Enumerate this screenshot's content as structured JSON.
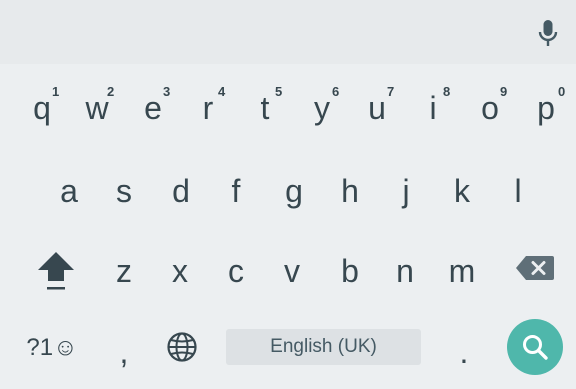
{
  "suggestion_bar": {
    "mic_icon": "microphone-icon"
  },
  "rows": {
    "row1": [
      {
        "key": "q",
        "hint": "1"
      },
      {
        "key": "w",
        "hint": "2"
      },
      {
        "key": "e",
        "hint": "3"
      },
      {
        "key": "r",
        "hint": "4"
      },
      {
        "key": "t",
        "hint": "5"
      },
      {
        "key": "y",
        "hint": "6"
      },
      {
        "key": "u",
        "hint": "7"
      },
      {
        "key": "i",
        "hint": "8"
      },
      {
        "key": "o",
        "hint": "9"
      },
      {
        "key": "p",
        "hint": "0"
      }
    ],
    "row2": [
      "a",
      "s",
      "d",
      "f",
      "g",
      "h",
      "j",
      "k",
      "l"
    ],
    "row3": [
      "z",
      "x",
      "c",
      "v",
      "b",
      "n",
      "m"
    ]
  },
  "bottom": {
    "symbols_label": "?1☺",
    "comma": ",",
    "period": ".",
    "space_label": "English (UK)"
  },
  "colors": {
    "background": "#eceff1",
    "text": "#37474f",
    "accent": "#4fb7ab",
    "space_key": "#dde1e4"
  }
}
